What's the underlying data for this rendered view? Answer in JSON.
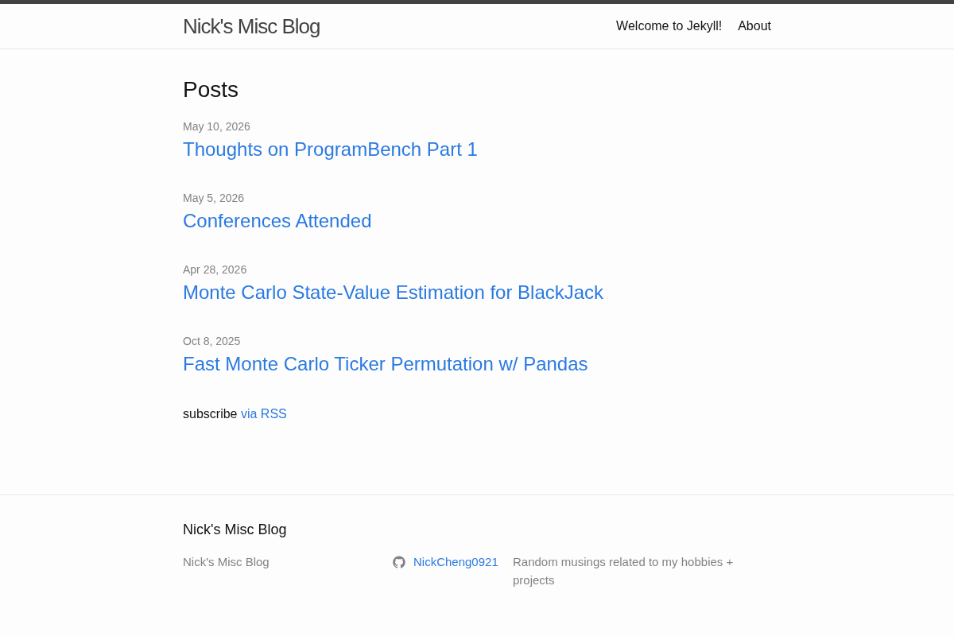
{
  "header": {
    "site_title": "Nick's Misc Blog",
    "nav": [
      "Welcome to Jekyll!",
      "About"
    ]
  },
  "main": {
    "heading": "Posts",
    "posts": [
      {
        "date": "May 10, 2026",
        "title": "Thoughts on ProgramBench Part 1"
      },
      {
        "date": "May 5, 2026",
        "title": "Conferences Attended"
      },
      {
        "date": "Apr 28, 2026",
        "title": "Monte Carlo State-Value Estimation for BlackJack"
      },
      {
        "date": "Oct 8, 2025",
        "title": "Fast Monte Carlo Ticker Permutation w/ Pandas"
      }
    ],
    "subscribe": {
      "text": "subscribe",
      "link": "via RSS"
    }
  },
  "footer": {
    "heading": "Nick's Misc Blog",
    "site_name": "Nick's Misc Blog",
    "social": [
      {
        "kind": "github",
        "username": "NickCheng0921"
      }
    ],
    "description": "Random musings related to my hobbies + projects"
  }
}
